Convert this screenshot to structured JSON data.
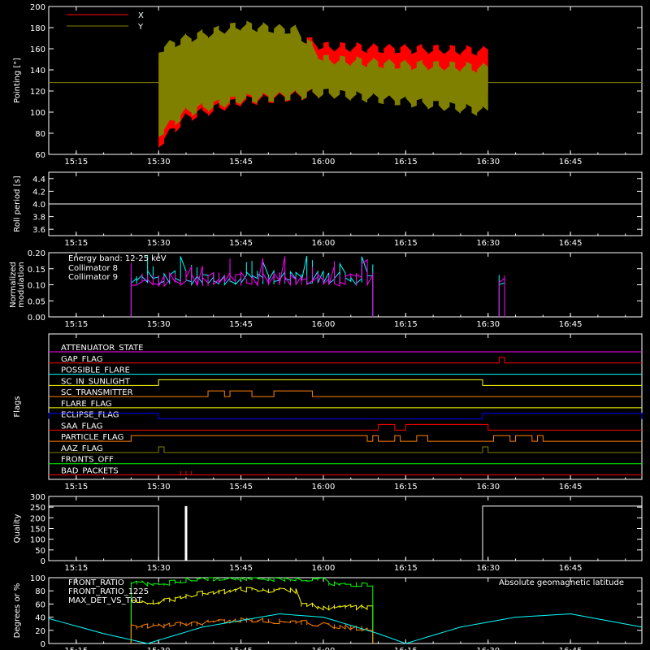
{
  "time_axis": {
    "tmin": "15:10",
    "tmax": "16:58",
    "tick_labels": [
      "15:15",
      "15:30",
      "15:45",
      "16:00",
      "16:15",
      "16:30",
      "16:45"
    ]
  },
  "chart_data": [
    {
      "id": "pointing",
      "type": "area",
      "ylabel": "Pointing [\"]",
      "ylim": [
        60,
        200
      ],
      "yticks": [
        60,
        80,
        100,
        120,
        140,
        160,
        180,
        200
      ],
      "legend": [
        {
          "name": "X",
          "color": "#ff0000"
        },
        {
          "name": "Y",
          "color": "#808000"
        }
      ],
      "constant_line": {
        "value": 128,
        "color": "#808000"
      },
      "series": [
        {
          "name": "X",
          "color": "#ff0000",
          "upper": [
            [
              "15:30",
              155
            ],
            [
              "15:35",
              168
            ],
            [
              "15:45",
              175
            ],
            [
              "15:55",
              172
            ],
            [
              "16:00",
              162
            ],
            [
              "16:15",
              160
            ],
            [
              "16:30",
              158
            ]
          ],
          "lower": [
            [
              "15:30",
              70
            ],
            [
              "15:35",
              95
            ],
            [
              "15:45",
              110
            ],
            [
              "16:00",
              118
            ],
            [
              "16:15",
              122
            ],
            [
              "16:30",
              118
            ]
          ]
        },
        {
          "name": "Y",
          "color": "#808000",
          "upper": [
            [
              "15:30",
              160
            ],
            [
              "15:35",
              170
            ],
            [
              "15:45",
              182
            ],
            [
              "15:55",
              178
            ],
            [
              "16:00",
              150
            ],
            [
              "16:15",
              145
            ],
            [
              "16:30",
              142
            ]
          ],
          "lower": [
            [
              "15:30",
              80
            ],
            [
              "15:35",
              100
            ],
            [
              "15:45",
              112
            ],
            [
              "16:00",
              118
            ],
            [
              "16:15",
              110
            ],
            [
              "16:30",
              100
            ]
          ]
        }
      ]
    },
    {
      "id": "roll",
      "type": "line",
      "ylabel": "Roll period [s]",
      "ylim": [
        3.5,
        4.5
      ],
      "yticks": [
        3.6,
        3.8,
        4.0,
        4.2,
        4.4
      ],
      "series": [
        {
          "name": "",
          "color": "#ffffff",
          "points": [
            [
              "15:10",
              4.0
            ],
            [
              "16:58",
              4.0
            ]
          ]
        }
      ]
    },
    {
      "id": "modulation",
      "type": "line",
      "ylabel": "Normalized modulation",
      "ylim": [
        0,
        0.2
      ],
      "yticks": [
        0.0,
        0.05,
        0.1,
        0.15,
        0.2
      ],
      "annotation": "Energy band: 12-25 keV",
      "series": [
        {
          "name": "Collimator 8",
          "color": "#00ffff",
          "segments": [
            [
              "15:25",
              "16:09"
            ],
            [
              "16:32",
              "16:33"
            ]
          ],
          "level": 0.115
        },
        {
          "name": "Collimator 9",
          "color": "#ff00ff",
          "segments": [
            [
              "15:25",
              "16:09"
            ],
            [
              "16:32",
              "16:33"
            ]
          ],
          "level": 0.11
        }
      ]
    },
    {
      "id": "flags",
      "type": "line",
      "ylabel": "Flags",
      "flags": [
        {
          "name": "ATTENUATOR_STATE",
          "color": "#ff00ff",
          "steps": []
        },
        {
          "name": "GAP_FLAG",
          "color": "#ff0000",
          "steps": [
            [
              "16:32",
              "16:33"
            ]
          ]
        },
        {
          "name": "POSSIBLE_FLARE",
          "color": "#00ffff",
          "steps": []
        },
        {
          "name": "SC_IN_SUNLIGHT",
          "color": "#ffff00",
          "steps": [
            [
              "15:30",
              "16:29"
            ]
          ]
        },
        {
          "name": "SC_TRANSMITTER",
          "color": "#ff8000",
          "steps": [
            [
              "15:39",
              "15:42"
            ],
            [
              "15:43",
              "15:47"
            ],
            [
              "15:51",
              "15:58"
            ]
          ]
        },
        {
          "name": "FLARE_FLAG",
          "color": "#ffff00",
          "steps": []
        },
        {
          "name": "ECLIPSE_FLAG",
          "color": "#0000ff",
          "steps": [
            [
              "15:10",
              "15:30"
            ],
            [
              "16:29",
              "16:58"
            ]
          ]
        },
        {
          "name": "SAA_FLAG",
          "color": "#ff0000",
          "steps": [
            [
              "16:10",
              "16:13"
            ],
            [
              "16:15",
              "16:30"
            ]
          ]
        },
        {
          "name": "PARTICLE_FLAG",
          "color": "#ff8000",
          "steps": [
            [
              "15:25",
              "16:08"
            ],
            [
              "16:09",
              "16:10"
            ],
            [
              "16:13",
              "16:14"
            ],
            [
              "16:17",
              "16:19"
            ],
            [
              "16:31",
              "16:34"
            ],
            [
              "16:35",
              "16:38"
            ],
            [
              "16:39",
              "16:40"
            ]
          ]
        },
        {
          "name": "AAZ_FLAG",
          "color": "#808000",
          "steps": [
            [
              "15:30",
              "15:31"
            ],
            [
              "16:29",
              "16:30"
            ]
          ]
        },
        {
          "name": "FRONTS_OFF",
          "color": "#00ff00",
          "steps": []
        },
        {
          "name": "BAD_PACKETS",
          "color": "#ff0000",
          "ticks": [
            "15:34",
            "15:35",
            "15:36"
          ]
        }
      ]
    },
    {
      "id": "quality",
      "type": "line",
      "ylabel": "Quality",
      "ylim": [
        0,
        300
      ],
      "yticks": [
        0,
        50,
        100,
        150,
        200,
        250,
        300
      ],
      "series": [
        {
          "name": "",
          "color": "#ffffff",
          "points": [
            [
              "15:10",
              255
            ],
            [
              "15:30",
              255
            ],
            [
              "15:30",
              0
            ],
            [
              "16:29",
              0
            ],
            [
              "16:29",
              255
            ],
            [
              "16:58",
              255
            ]
          ],
          "spikes": [
            [
              "15:35",
              255
            ]
          ]
        }
      ]
    },
    {
      "id": "ratios",
      "type": "line",
      "ylabel": "Degrees or %",
      "ylim": [
        0,
        100
      ],
      "yticks": [
        0,
        20,
        40,
        60,
        80,
        100
      ],
      "annotation": "Absolute geomagnetic latitude",
      "series": [
        {
          "name": "FRONT_RATIO",
          "color": "#ffff00",
          "points": [
            [
              "15:25",
              65
            ],
            [
              "15:30",
              62
            ],
            [
              "15:37",
              75
            ],
            [
              "15:45",
              82
            ],
            [
              "15:55",
              80
            ],
            [
              "15:56",
              60
            ],
            [
              "16:00",
              55
            ],
            [
              "16:09",
              55
            ]
          ]
        },
        {
          "name": "FRONT_RATIO_1225",
          "color": "#00ff00",
          "points": [
            [
              "15:25",
              92
            ],
            [
              "15:30",
              90
            ],
            [
              "15:37",
              99
            ],
            [
              "16:00",
              98
            ],
            [
              "16:01",
              90
            ],
            [
              "16:09",
              90
            ]
          ]
        },
        {
          "name": "MAX_DET_VS_TOT",
          "color": "#ff8000",
          "points": [
            [
              "15:25",
              25
            ],
            [
              "15:40",
              32
            ],
            [
              "15:45",
              36
            ],
            [
              "15:55",
              33
            ],
            [
              "16:00",
              28
            ],
            [
              "16:09",
              22
            ]
          ]
        },
        {
          "name": "Absolute geomagnetic latitude",
          "color": "#00ffff",
          "points": [
            [
              "15:10",
              38
            ],
            [
              "15:20",
              15
            ],
            [
              "15:28",
              0
            ],
            [
              "15:38",
              25
            ],
            [
              "15:52",
              45
            ],
            [
              "16:00",
              40
            ],
            [
              "16:10",
              15
            ],
            [
              "16:15",
              0
            ],
            [
              "16:25",
              25
            ],
            [
              "16:35",
              40
            ],
            [
              "16:45",
              45
            ],
            [
              "16:58",
              25
            ]
          ]
        }
      ]
    }
  ]
}
